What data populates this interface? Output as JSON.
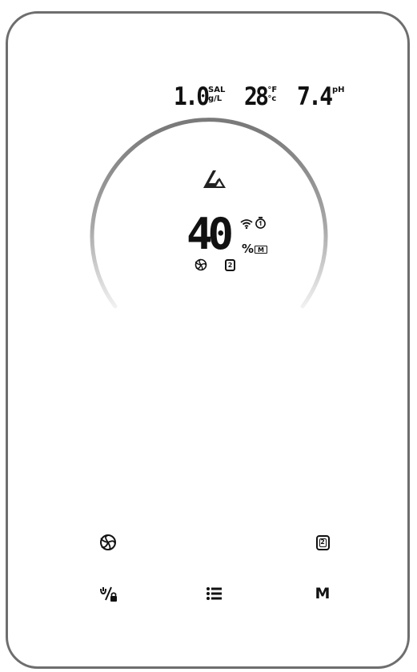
{
  "colors": {
    "frame": "#6e6e6e",
    "arc_dark": "#7a7a7a",
    "arc_light": "#f2f2f2",
    "text": "#111111"
  },
  "status_bar": {
    "salinity": {
      "value": "1.0",
      "unit_top": "SAL",
      "unit_bottom": "g/L"
    },
    "temperature": {
      "value": "28",
      "unit_top": "°F",
      "unit_bottom": "°c"
    },
    "ph": {
      "value": "7.4",
      "unit": "pH"
    }
  },
  "display": {
    "logo_icon": "brand-logo-icon",
    "percent_value": "40",
    "percent_sign": "%",
    "mode_indicator": "M",
    "box_number": "2",
    "icons": [
      "wifi-icon",
      "timer-icon",
      "fan-icon",
      "box-2-icon"
    ]
  },
  "controls": {
    "row1": [
      {
        "name": "fan-button",
        "icon": "fan-icon"
      },
      {
        "name": "box-2-button",
        "icon": "box-2-icon",
        "label": "2"
      }
    ],
    "row2": [
      {
        "name": "power-lock-button",
        "icon": "power-lock-icon"
      },
      {
        "name": "menu-list-button",
        "icon": "list-icon"
      },
      {
        "name": "mode-button",
        "label": "M"
      }
    ]
  }
}
